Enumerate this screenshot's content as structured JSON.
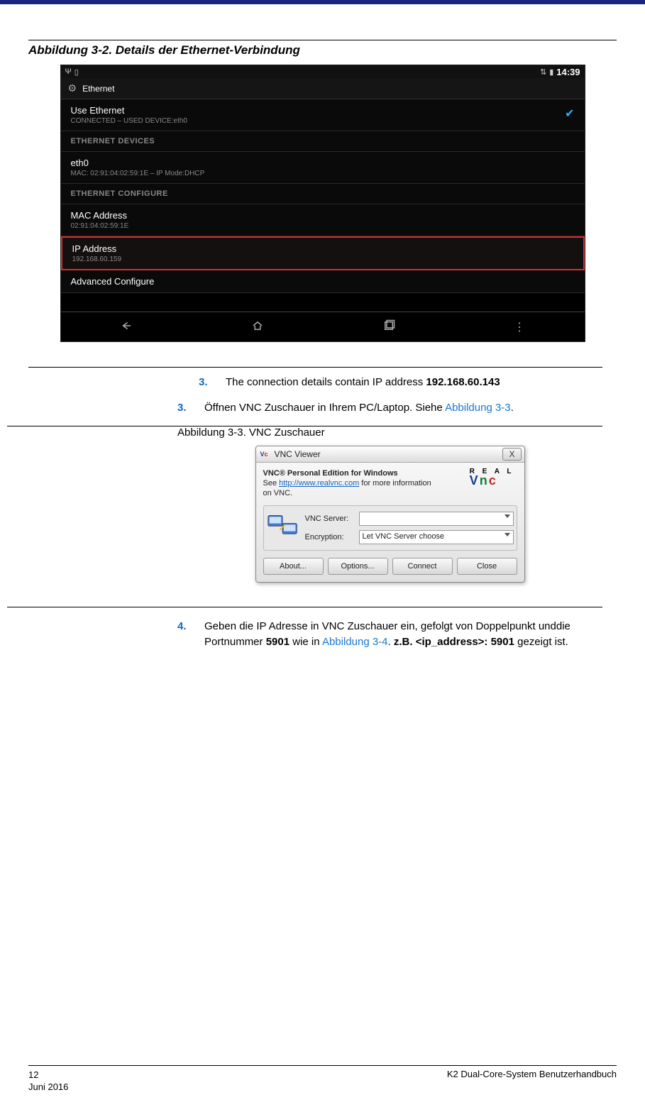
{
  "figure1": {
    "caption": "Abbildung 3-2. Details der Ethernet-Verbindung",
    "clock": "14:39",
    "activity_title": "Ethernet",
    "rows": {
      "use_ethernet": {
        "label": "Use Ethernet",
        "sub": "CONNECTED – USED DEVICE:eth0"
      },
      "devices_header": "ETHERNET DEVICES",
      "eth0": {
        "label": "eth0",
        "sub": "MAC: 02:91:04:02:59:1E – IP Mode:DHCP"
      },
      "config_header": "ETHERNET CONFIGURE",
      "mac": {
        "label": "MAC Address",
        "sub": "02:91:04:02:59:1E"
      },
      "ip": {
        "label": "IP Address",
        "sub": "192.168.60.159"
      },
      "advanced": {
        "label": "Advanced Configure"
      }
    }
  },
  "step3a": {
    "num": "3.",
    "text_a": "The connection details contain IP address ",
    "ip": "192.168.60.143"
  },
  "step3b": {
    "num": "3.",
    "text_a": "Öffnen VNC Zuschauer in Ihrem PC/Laptop. Siehe ",
    "link": "Abbildung 3-3",
    "text_b": "."
  },
  "figure2": {
    "caption": "Abbildung 3-3. VNC Zuschauer",
    "title": "VNC Viewer",
    "info_header": "VNC® Personal Edition for Windows",
    "info_a": "See ",
    "info_url": "http://www.realvnc.com",
    "info_b": " for more information on VNC.",
    "server_label": "VNC Server:",
    "enc_label": "Encryption:",
    "enc_value": "Let VNC Server choose",
    "buttons": {
      "about": "About...",
      "options": "Options...",
      "connect": "Connect",
      "close": "Close"
    }
  },
  "step4": {
    "num": "4.",
    "text_a": "Geben die IP Adresse in VNC Zuschauer ein, gefolgt von Doppelpunkt unddie Portnummer ",
    "port": "5901",
    "text_b": " wie in ",
    "link": "Abbildung 3-4",
    "text_c": ".  ",
    "eg_label": "z.B. <ip_address>: 5901",
    "text_d": " gezeigt ist."
  },
  "footer": {
    "page": "12",
    "date": "Juni 2016",
    "doc": "K2 Dual-Core-System Benutzerhandbuch"
  }
}
